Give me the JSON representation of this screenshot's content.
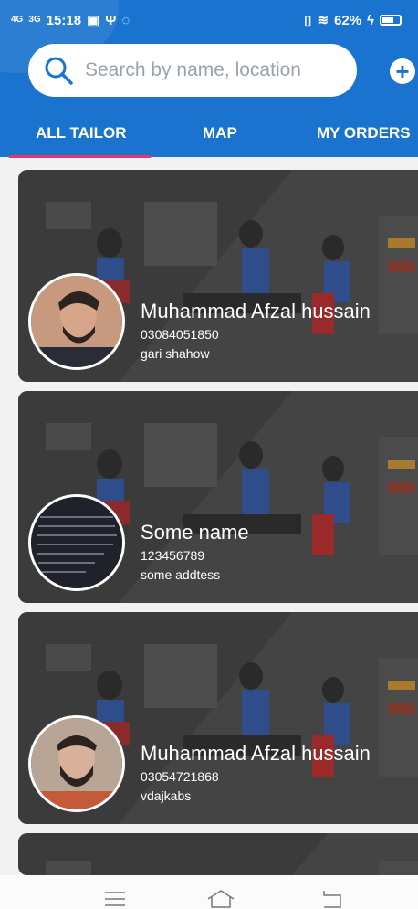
{
  "status": {
    "signal1": "4G",
    "signal2": "3G",
    "time": "15:18",
    "battery": "62%"
  },
  "search": {
    "placeholder": "Search by name, location"
  },
  "tabs": [
    "ALL TAILOR",
    "MAP",
    "MY ORDERS"
  ],
  "tailors": [
    {
      "name": "Muhammad Afzal hussain",
      "phone": "03084051850",
      "address": "gari shahow"
    },
    {
      "name": "Some name",
      "phone": "123456789",
      "address": "some addtess"
    },
    {
      "name": "Muhammad Afzal hussain",
      "phone": "03054721868",
      "address": "vdajkabs"
    }
  ],
  "colors": {
    "primary": "#1a74cf",
    "indicator": "#e0396f"
  }
}
